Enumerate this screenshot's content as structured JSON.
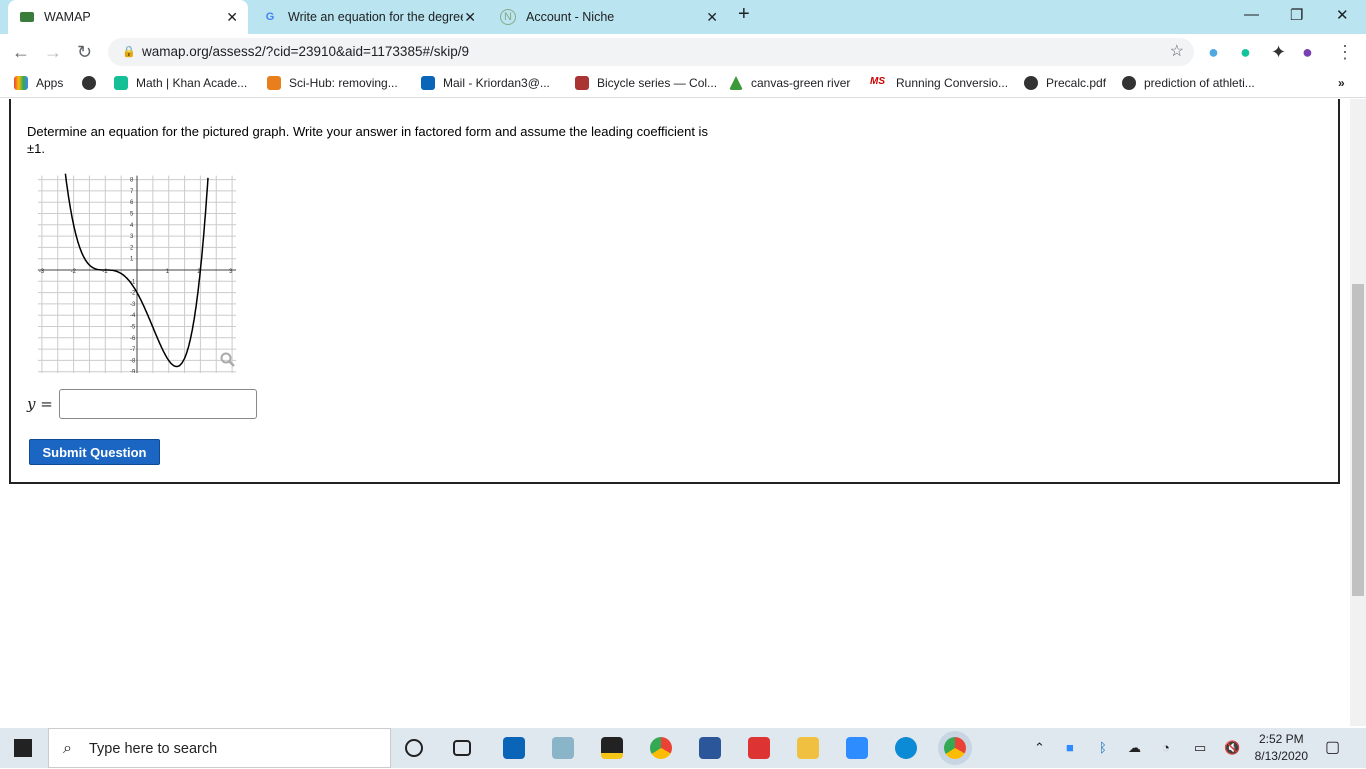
{
  "browser": {
    "tabs": [
      {
        "label": "WAMAP",
        "active": true
      },
      {
        "label": "Write an equation for the degree",
        "active": false
      },
      {
        "label": "Account - Niche",
        "active": false
      }
    ],
    "url": "wamap.org/assess2/?cid=23910&aid=1173385#/skip/9",
    "bookmarks": [
      "Apps",
      "Math | Khan Acade...",
      "Sci-Hub: removing...",
      "Mail - Kriordan3@...",
      "Bicycle series — Col...",
      "canvas-green river",
      "Running Conversio...",
      "Precalc.pdf",
      "prediction of athleti..."
    ]
  },
  "question": {
    "text": "Determine an equation for the pictured graph. Write your answer in factored form and assume the leading coefficient is ±1.",
    "answer_label": "y =",
    "answer_value": "",
    "submit_label": "Submit Question"
  },
  "chart_data": {
    "type": "line",
    "title": "",
    "xlabel": "",
    "ylabel": "",
    "xlim": [
      -3,
      3
    ],
    "ylim": [
      -9,
      8
    ],
    "xticks": [
      "-3",
      "-2",
      "-1",
      "1",
      "2",
      "3"
    ],
    "yticks": [
      "8",
      "7",
      "6",
      "5",
      "4",
      "3",
      "2",
      "1",
      "-1",
      "-2",
      "-3",
      "-4",
      "-5",
      "-6",
      "-7",
      "-8",
      "-9"
    ],
    "grid": true,
    "function": "(x+1)^3 (x-2)",
    "key_points": [
      {
        "x": -1,
        "y": 0
      },
      {
        "x": 0,
        "y": -2
      },
      {
        "x": 1.25,
        "y": -8.54
      },
      {
        "x": 2,
        "y": 0
      }
    ]
  },
  "taskbar": {
    "search_placeholder": "Type here to search",
    "time": "2:52 PM",
    "date": "8/13/2020"
  },
  "colors": {
    "accent": "#1a66c2",
    "tabbar": "#b9e4f0"
  }
}
